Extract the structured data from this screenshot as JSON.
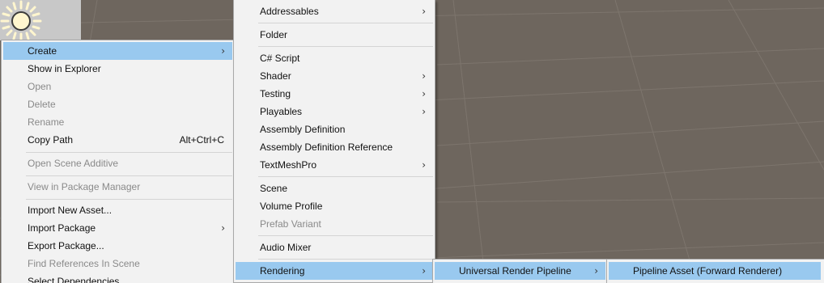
{
  "context_menu": {
    "items": [
      {
        "label": "Create",
        "has_submenu": true,
        "selected": true
      },
      {
        "label": "Show in Explorer"
      },
      {
        "label": "Open",
        "disabled": true
      },
      {
        "label": "Delete",
        "disabled": true
      },
      {
        "label": "Rename",
        "disabled": true
      },
      {
        "label": "Copy Path",
        "shortcut": "Alt+Ctrl+C"
      },
      {
        "label": "Open Scene Additive",
        "disabled": true
      },
      {
        "label": "View in Package Manager",
        "disabled": true
      },
      {
        "label": "Import New Asset..."
      },
      {
        "label": "Import Package",
        "has_submenu": true
      },
      {
        "label": "Export Package..."
      },
      {
        "label": "Find References In Scene",
        "disabled": true
      },
      {
        "label": "Select Dependencies"
      }
    ]
  },
  "create_submenu": {
    "items": [
      {
        "label": "Addressables",
        "has_submenu": true
      },
      {
        "label": "Folder"
      },
      {
        "label": "C# Script"
      },
      {
        "label": "Shader",
        "has_submenu": true
      },
      {
        "label": "Testing",
        "has_submenu": true
      },
      {
        "label": "Playables",
        "has_submenu": true
      },
      {
        "label": "Assembly Definition"
      },
      {
        "label": "Assembly Definition Reference"
      },
      {
        "label": "TextMeshPro",
        "has_submenu": true
      },
      {
        "label": "Scene"
      },
      {
        "label": "Volume Profile"
      },
      {
        "label": "Prefab Variant",
        "disabled": true
      },
      {
        "label": "Audio Mixer"
      },
      {
        "label": "Rendering",
        "has_submenu": true,
        "selected": true
      }
    ]
  },
  "rendering_submenu": {
    "items": [
      {
        "label": "Universal Render Pipeline",
        "has_submenu": true,
        "selected": true
      }
    ]
  },
  "urp_submenu": {
    "items": [
      {
        "label": "Pipeline Asset (Forward Renderer)",
        "selected": true
      }
    ]
  },
  "glyphs": {
    "submenu_arrow": "›"
  },
  "colors": {
    "highlight": "#99c9ef",
    "scene_bg": "#6e665e",
    "menu_bg": "#f2f2f2"
  },
  "scene": {
    "light_icon": "sun-icon"
  }
}
